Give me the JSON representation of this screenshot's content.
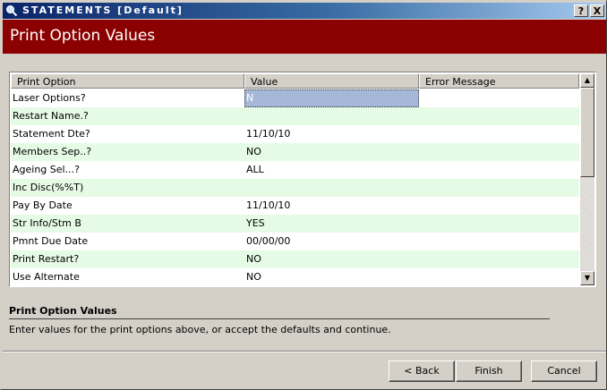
{
  "window": {
    "title": "STATEMENTS [Default]",
    "help_button": "?",
    "close_button": "X"
  },
  "banner": {
    "title": "Print Option Values"
  },
  "grid": {
    "columns": [
      "Print Option",
      "Value",
      "Error Message"
    ],
    "rows": [
      {
        "option": "Laser Options?",
        "value": "N",
        "error": ""
      },
      {
        "option": "Restart Name.?",
        "value": "",
        "error": ""
      },
      {
        "option": "Statement Dte?",
        "value": "11/10/10",
        "error": ""
      },
      {
        "option": "Members Sep..?",
        "value": "NO",
        "error": ""
      },
      {
        "option": "Ageing Sel...?",
        "value": "ALL",
        "error": ""
      },
      {
        "option": "Inc Disc(%%T)",
        "value": "",
        "error": ""
      },
      {
        "option": "Pay By Date",
        "value": "11/10/10",
        "error": ""
      },
      {
        "option": "Str Info/Stm B",
        "value": "YES",
        "error": ""
      },
      {
        "option": "Pmnt Due Date",
        "value": "00/00/00",
        "error": ""
      },
      {
        "option": "Print Restart?",
        "value": "NO",
        "error": ""
      },
      {
        "option": "Use Alternate",
        "value": "NO",
        "error": ""
      }
    ],
    "scroll_up": "▲",
    "scroll_down": "▼"
  },
  "help": {
    "title": "Print Option Values",
    "text": "Enter values for the print options above, or accept the defaults and continue."
  },
  "buttons": {
    "back": "< Back",
    "finish": "Finish",
    "cancel": "Cancel"
  },
  "colors": {
    "banner": "#8b0000",
    "alt_row": "#e6fbe6",
    "selected": "#a6b8d8"
  }
}
